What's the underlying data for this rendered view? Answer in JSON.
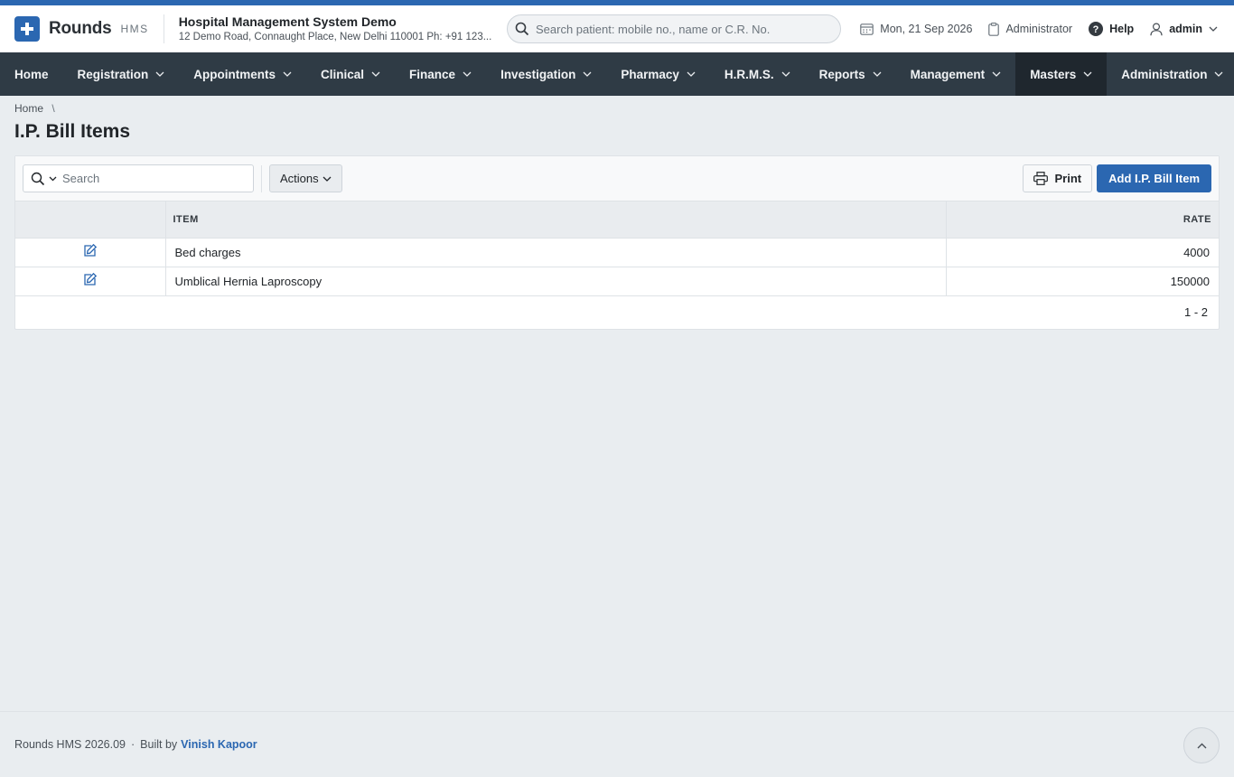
{
  "app": {
    "name": "Rounds",
    "sub": "HMS"
  },
  "hospital": {
    "name": "Hospital Management System Demo",
    "address": "12 Demo Road, Connaught Place, New Delhi 110001 Ph: +91 123..."
  },
  "header": {
    "search_placeholder": "Search patient: mobile no., name or C.R. No.",
    "date": "Mon, 21 Sep 2026",
    "role": "Administrator",
    "help": "Help",
    "user": "admin"
  },
  "nav": [
    {
      "label": "Home",
      "dropdown": false
    },
    {
      "label": "Registration",
      "dropdown": true
    },
    {
      "label": "Appointments",
      "dropdown": true
    },
    {
      "label": "Clinical",
      "dropdown": true
    },
    {
      "label": "Finance",
      "dropdown": true
    },
    {
      "label": "Investigation",
      "dropdown": true
    },
    {
      "label": "Pharmacy",
      "dropdown": true
    },
    {
      "label": "H.R.M.S.",
      "dropdown": true
    },
    {
      "label": "Reports",
      "dropdown": true
    },
    {
      "label": "Management",
      "dropdown": true
    },
    {
      "label": "Masters",
      "dropdown": true,
      "active": true
    },
    {
      "label": "Administration",
      "dropdown": true
    }
  ],
  "breadcrumb": {
    "home": "Home",
    "separator": "\\"
  },
  "page": {
    "title": "I.P. Bill Items"
  },
  "toolbar": {
    "search_placeholder": "Search",
    "actions": "Actions",
    "print": "Print",
    "add": "Add I.P. Bill Item"
  },
  "table": {
    "headers": [
      "",
      "ITEM",
      "RATE"
    ],
    "rows": [
      {
        "item": "Bed charges",
        "rate": "4000"
      },
      {
        "item": "Umblical Hernia Laproscopy",
        "rate": "150000"
      }
    ],
    "pager": "1 - 2"
  },
  "footer": {
    "version": "Rounds HMS 2026.09",
    "dot": "·",
    "built_by": "Built by",
    "author": "Vinish Kapoor"
  },
  "colors": {
    "brand": "#2b67b1",
    "nav_bg": "#2f3b45",
    "nav_active": "#1f272e"
  }
}
